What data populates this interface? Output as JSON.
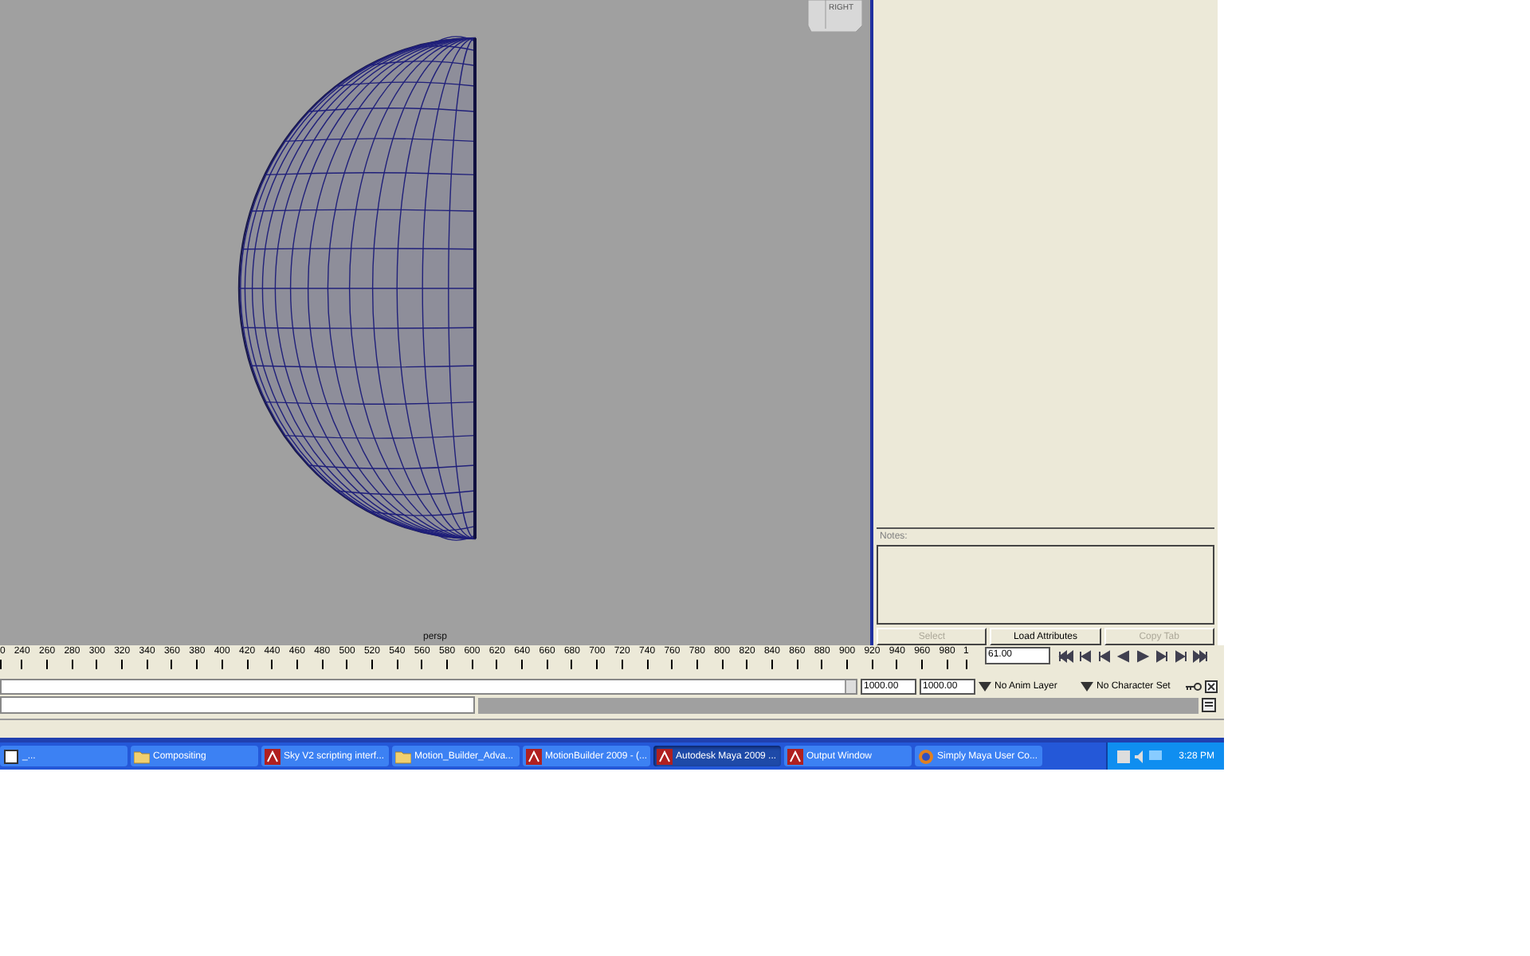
{
  "viewport": {
    "camera_label": "persp",
    "view_cube": {
      "face": "RIGHT"
    }
  },
  "attribute_editor": {
    "notes_label": "Notes:",
    "buttons": [
      {
        "label": "Select",
        "disabled": true
      },
      {
        "label": "Load Attributes",
        "disabled": false
      },
      {
        "label": "Copy Tab",
        "disabled": true
      }
    ]
  },
  "time_slider": {
    "ruler_labels": [
      "0",
      "240",
      "260",
      "280",
      "300",
      "320",
      "340",
      "360",
      "380",
      "400",
      "420",
      "440",
      "460",
      "480",
      "500",
      "520",
      "540",
      "560",
      "580",
      "600",
      "620",
      "640",
      "660",
      "680",
      "700",
      "720",
      "740",
      "760",
      "780",
      "800",
      "820",
      "840",
      "860",
      "880",
      "900",
      "920",
      "940",
      "960",
      "980",
      "1"
    ],
    "current_frame": "61.00"
  },
  "range_slider": {
    "level": 1,
    "start": "1000.00",
    "end": "1000.00",
    "anim_layer": "No Anim Layer",
    "character_set": "No Character Set"
  },
  "taskbar": {
    "items": [
      {
        "label": "_...",
        "selected": false,
        "kind": "window"
      },
      {
        "label": "Compositing",
        "selected": false,
        "kind": "folder"
      },
      {
        "label": "Sky V2 scripting interf...",
        "selected": false,
        "kind": "app"
      },
      {
        "label": "Motion_Builder_Adva...",
        "selected": false,
        "kind": "folder"
      },
      {
        "label": "MotionBuilder 2009 - (...",
        "selected": false,
        "kind": "app"
      },
      {
        "label": "Autodesk Maya 2009 ...",
        "selected": true,
        "kind": "app"
      },
      {
        "label": "Output Window",
        "selected": false,
        "kind": "app"
      },
      {
        "label": "Simply Maya User Co...",
        "selected": false,
        "kind": "browser"
      }
    ],
    "clock": "3:28 PM"
  }
}
